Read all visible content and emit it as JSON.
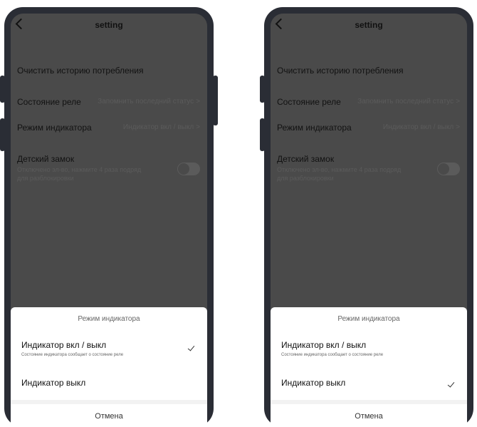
{
  "phones": [
    {
      "header": {
        "title": "setting"
      },
      "settings": {
        "clear_history": "Очистить историю потребления",
        "relay_state": {
          "label": "Состояние реле",
          "value": "Запомнить последний статус",
          "chevron": ">"
        },
        "indicator_mode": {
          "label": "Режим индикатора",
          "value": "Индикатор вкл / выкл",
          "chevron": ">"
        },
        "child_lock": {
          "label": "Детский замок",
          "description_line1": "Отключено эл-во, нажмите 4 раза подряд",
          "description_line2": "для разблокировки",
          "enabled": false
        }
      },
      "sheet": {
        "title": "Режим индикатора",
        "options": [
          {
            "label": "Индикатор вкл / выкл",
            "description": "Состояние индикатора сообщает о состояние реле",
            "selected": true
          },
          {
            "label": "Индикатор выкл",
            "selected": false
          }
        ],
        "cancel": "Отмена",
        "check_icon": "✓"
      }
    },
    {
      "header": {
        "title": "setting"
      },
      "settings": {
        "clear_history": "Очистить историю потребления",
        "relay_state": {
          "label": "Состояние реле",
          "value": "Запомнить последний статус",
          "chevron": ">"
        },
        "indicator_mode": {
          "label": "Режим индикатора",
          "value": "Индикатор вкл / выкл",
          "chevron": ">"
        },
        "child_lock": {
          "label": "Детский замок",
          "description_line1": "Отключено эл-во, нажмите 4 раза подряд",
          "description_line2": "для разблокировки",
          "enabled": false
        }
      },
      "sheet": {
        "title": "Режим индикатора",
        "options": [
          {
            "label": "Индикатор вкл / выкл",
            "description": "Состояние индикатора сообщает о состояние реле",
            "selected": false
          },
          {
            "label": "Индикатор выкл",
            "selected": true
          }
        ],
        "cancel": "Отмена",
        "check_icon": "✓"
      }
    }
  ]
}
